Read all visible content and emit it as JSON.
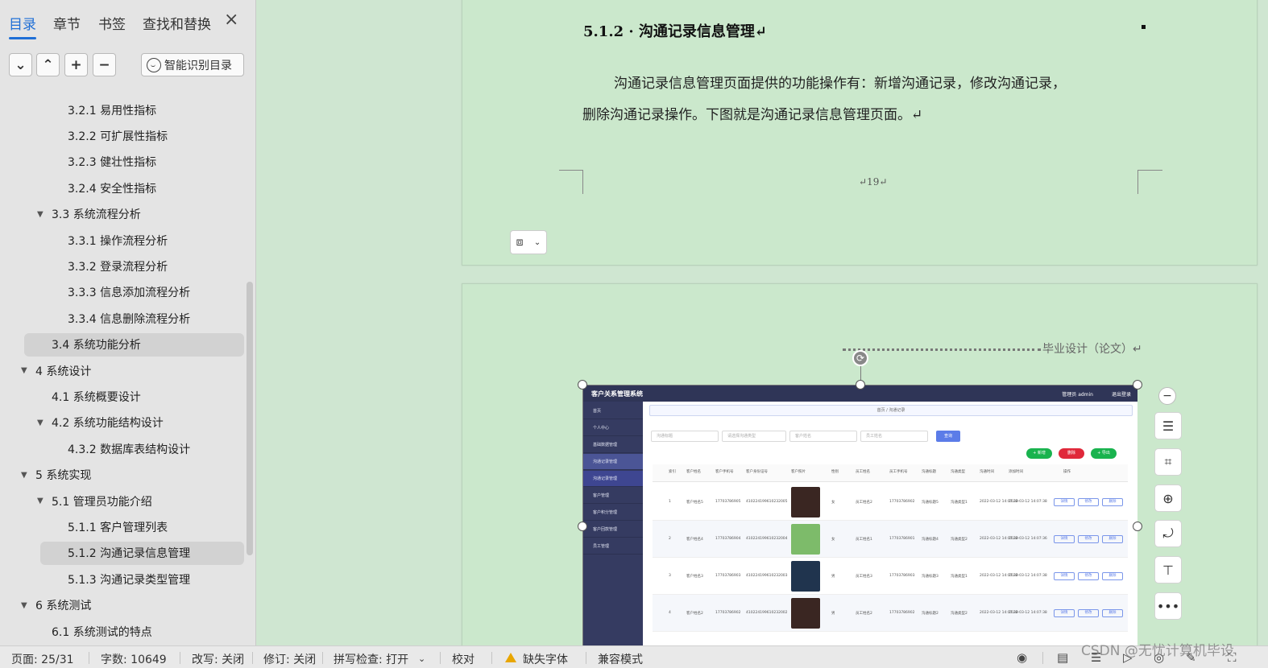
{
  "nav": {
    "tabs": [
      "目录",
      "章节",
      "书签",
      "查找和替换"
    ],
    "close_icon": "×",
    "tool_buttons": [
      "⌄",
      "⌃",
      "+",
      "−"
    ],
    "smart_button": "智能识别目录",
    "toc": [
      {
        "label": "3.2.1  易用性指标",
        "level": 3,
        "arrow": false,
        "selected": false
      },
      {
        "label": "3.2.2  可扩展性指标",
        "level": 3,
        "arrow": false,
        "selected": false
      },
      {
        "label": "3.2.3  健壮性指标",
        "level": 3,
        "arrow": false,
        "selected": false
      },
      {
        "label": "3.2.4  安全性指标",
        "level": 3,
        "arrow": false,
        "selected": false
      },
      {
        "label": "3.3  系统流程分析",
        "level": 2,
        "arrow": true,
        "selected": false
      },
      {
        "label": "3.3.1  操作流程分析",
        "level": 3,
        "arrow": false,
        "selected": false
      },
      {
        "label": "3.3.2  登录流程分析",
        "level": 3,
        "arrow": false,
        "selected": false
      },
      {
        "label": "3.3.3  信息添加流程分析",
        "level": 3,
        "arrow": false,
        "selected": false
      },
      {
        "label": "3.3.4  信息删除流程分析",
        "level": 3,
        "arrow": false,
        "selected": false
      },
      {
        "label": "3.4  系统功能分析",
        "level": 2,
        "arrow": false,
        "selected": true
      },
      {
        "label": "4  系统设计",
        "level": 1,
        "arrow": true,
        "selected": false
      },
      {
        "label": "4.1  系统概要设计",
        "level": 2,
        "arrow": false,
        "selected": false
      },
      {
        "label": "4.2  系统功能结构设计",
        "level": 2,
        "arrow": true,
        "selected": false
      },
      {
        "label": "4.3.2  数据库表结构设计",
        "level": 3,
        "arrow": false,
        "selected": false
      },
      {
        "label": "5  系统实现",
        "level": 1,
        "arrow": true,
        "selected": false
      },
      {
        "label": "5.1  管理员功能介绍",
        "level": 2,
        "arrow": true,
        "selected": false
      },
      {
        "label": "5.1.1  客户管理列表",
        "level": 3,
        "arrow": false,
        "selected": false
      },
      {
        "label": "5.1.2  沟通记录信息管理",
        "level": 3,
        "arrow": false,
        "selected": true
      },
      {
        "label": "5.1.3 沟通记录类型管理",
        "level": 3,
        "arrow": false,
        "selected": false
      },
      {
        "label": "6  系统测试",
        "level": 1,
        "arrow": true,
        "selected": false
      },
      {
        "label": "6.1  系统测试的特点",
        "level": 2,
        "arrow": false,
        "selected": false
      }
    ]
  },
  "doc": {
    "heading": "5.1.2 · 沟通记录信息管理↵",
    "para_line1": "沟通记录信息管理页面提供的功能操作有：新增沟通记录，修改沟通记录，",
    "para_line2": "删除沟通记录操作。下图就是沟通记录信息管理页面。↵",
    "page_number": "↵19↵",
    "page2_header": "毕业设计（论文）↵"
  },
  "app": {
    "title": "客户关系管理系统",
    "user": "管理员 admin",
    "logout": "退出登录",
    "sidebar": [
      {
        "label": "首页",
        "state": ""
      },
      {
        "label": "个人中心",
        "state": ""
      },
      {
        "label": "基础数据管理",
        "state": ""
      },
      {
        "label": "沟通记录管理",
        "state": "active"
      },
      {
        "label": "沟通记录管理",
        "state": "sub"
      },
      {
        "label": "客户管理",
        "state": ""
      },
      {
        "label": "客户积分管理",
        "state": ""
      },
      {
        "label": "客户回款管理",
        "state": ""
      },
      {
        "label": "员工管理",
        "state": ""
      }
    ],
    "breadcrumb": "首页 / 沟通记录",
    "filters": [
      "沟通标题",
      "请选择沟通类型",
      "客户姓名",
      "员工姓名"
    ],
    "search": "查询",
    "actions": [
      {
        "label": "+ 新增",
        "color": "#19b34e"
      },
      {
        "label": "删除",
        "color": "#e0283a"
      },
      {
        "label": "+ 导出",
        "color": "#19b34e"
      }
    ],
    "columns": [
      "索引",
      "客户姓名",
      "客户手机号",
      "客户身份证号",
      "客户照片",
      "性别",
      "员工姓名",
      "员工手机号",
      "沟通标题",
      "沟通类型",
      "沟通时间",
      "添加时间",
      "操作"
    ],
    "row_buttons": [
      "详情",
      "修改",
      "删除"
    ],
    "rows": [
      {
        "idx": "1",
        "name": "客户姓名5",
        "phone": "17703786905",
        "idcard": "410224199610232005",
        "gender": "女",
        "staff": "员工姓名2",
        "staff_phone": "17703786902",
        "title": "沟通标题5",
        "type": "沟通类型1",
        "time": "2022-03-12 14:07:38",
        "added": "2022-03-12 14:07:38",
        "photo": "#3a2622"
      },
      {
        "idx": "2",
        "name": "客户姓名4",
        "phone": "17703786904",
        "idcard": "410224199610232004",
        "gender": "女",
        "staff": "员工姓名1",
        "staff_phone": "17703786901",
        "title": "沟通标题4",
        "type": "沟通类型2",
        "time": "2022-03-12 14:07:38",
        "added": "2022-03-12 14:07:36",
        "photo": "#7dbb6a"
      },
      {
        "idx": "3",
        "name": "客户姓名3",
        "phone": "17703786903",
        "idcard": "410224199610232003",
        "gender": "男",
        "staff": "员工姓名3",
        "staff_phone": "17703786903",
        "title": "沟通标题3",
        "type": "沟通类型1",
        "time": "2022-03-12 14:07:38",
        "added": "2022-03-12 14:07:38",
        "photo": "#20344e"
      },
      {
        "idx": "4",
        "name": "客户姓名2",
        "phone": "17703786902",
        "idcard": "410224199610232002",
        "gender": "男",
        "staff": "员工姓名2",
        "staff_phone": "17703786902",
        "title": "沟通标题2",
        "type": "沟通类型2",
        "time": "2022-03-12 14:07:38",
        "added": "2022-03-12 14:07:38",
        "photo": "#3a2622"
      }
    ]
  },
  "status": {
    "page": "页面: 25/31",
    "words": "字数: 10649",
    "overwrite": "改写: 关闭",
    "revision": "修订: 关闭",
    "spell": "拼写检查: 打开",
    "proof": "校对",
    "missing_font": "缺失字体",
    "compat": "兼容模式"
  },
  "watermark": "CSDN @无忧计算机毕设"
}
